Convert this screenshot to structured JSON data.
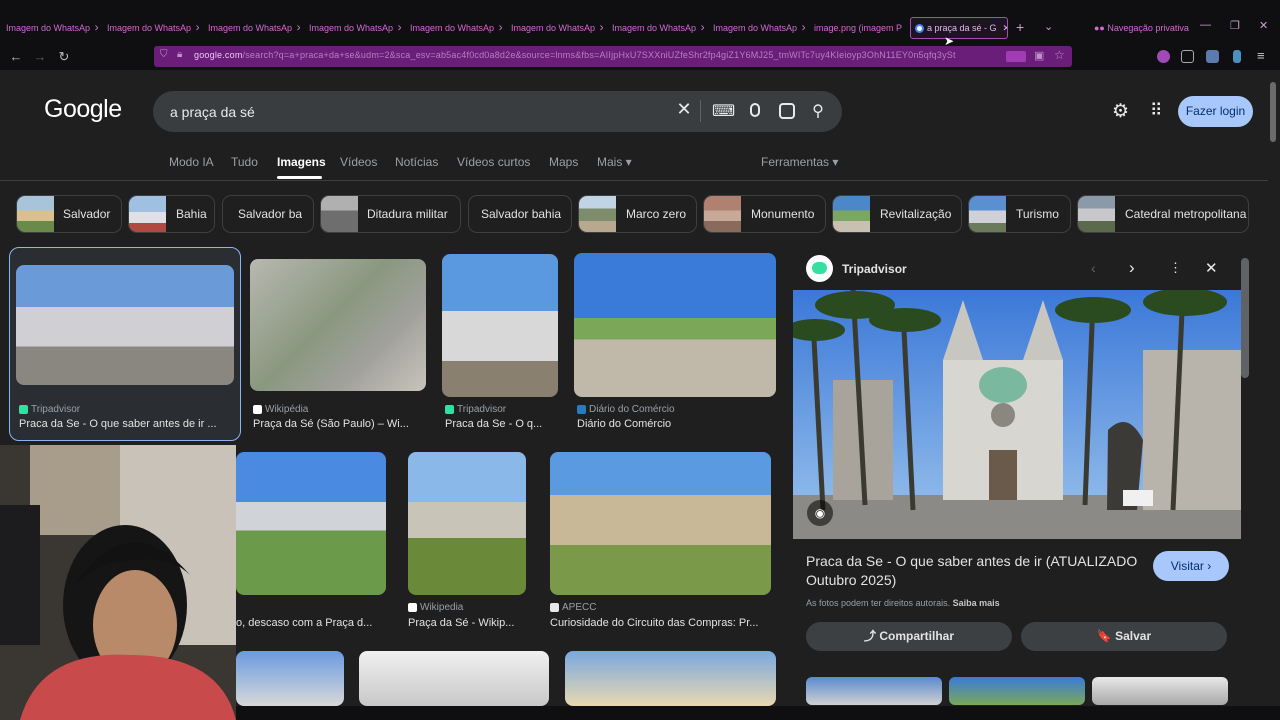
{
  "browser": {
    "tabs": [
      {
        "label": "Imagem do WhatsAp"
      },
      {
        "label": "Imagem do WhatsAp"
      },
      {
        "label": "Imagem do WhatsAp"
      },
      {
        "label": "Imagem do WhatsAp"
      },
      {
        "label": "Imagem do WhatsAp"
      },
      {
        "label": "Imagem do WhatsAp"
      },
      {
        "label": "Imagem do WhatsAp"
      },
      {
        "label": "Imagem do WhatsAp"
      },
      {
        "label": "image.png (imagem P"
      }
    ],
    "active_tab": "a praça da sé - G",
    "private_label": "Navegação privativa",
    "url_host": "google.com",
    "url_rest": "/search?q=a+praca+da+se&udm=2&sca_esv=ab5ac4f0cd0a8d2e&source=lnms&fbs=AIIjpHxU7SXXniUZfeShr2fp4giZ1Y6MJ25_tmWITc7uy4KIeioyp3OhN11EY0n5qfq3ySt",
    "accent": "#6a1e7a"
  },
  "google": {
    "logo": "Google",
    "query": "a praça da sé",
    "login": "Fazer login",
    "tabs": [
      "Modo IA",
      "Tudo",
      "Imagens",
      "Vídeos",
      "Notícias",
      "Vídeos curtos",
      "Maps",
      "Mais ▾"
    ],
    "tools": "Ferramentas ▾",
    "chips": [
      "Salvador",
      "Bahia",
      "Salvador ba",
      "Ditadura militar",
      "Salvador bahia",
      "Marco zero",
      "Monumento",
      "Revitalização",
      "Turismo",
      "Catedral metropolitana"
    ]
  },
  "results": [
    {
      "source": "Tripadvisor",
      "title": "Praca da Se - O que saber antes de ir ..."
    },
    {
      "source": "Wikipédia",
      "title": "Praça da Sé (São Paulo) – Wi..."
    },
    {
      "source": "Tripadvisor",
      "title": "Praca da Se - O q..."
    },
    {
      "source": "Diário do Comércio",
      "title": "Diário do Comércio"
    },
    {
      "source": "",
      "title": "o, descaso com a Praça d..."
    },
    {
      "source": "Wikipedia",
      "title": "Praça da Sé - Wikip..."
    },
    {
      "source": "APECC",
      "title": "Curiosidade do Circuito das Compras: Pr..."
    }
  ],
  "panel": {
    "source": "Tripadvisor",
    "heading": "Praca da Se - O que saber antes de ir (ATUALIZADO Outubro 2025)",
    "visit": "Visitar ›",
    "rights": "As fotos podem ter direitos autorais.",
    "learn_more": "Saiba mais",
    "share": "⤴ Compartilhar",
    "save": "🔖 Salvar"
  }
}
